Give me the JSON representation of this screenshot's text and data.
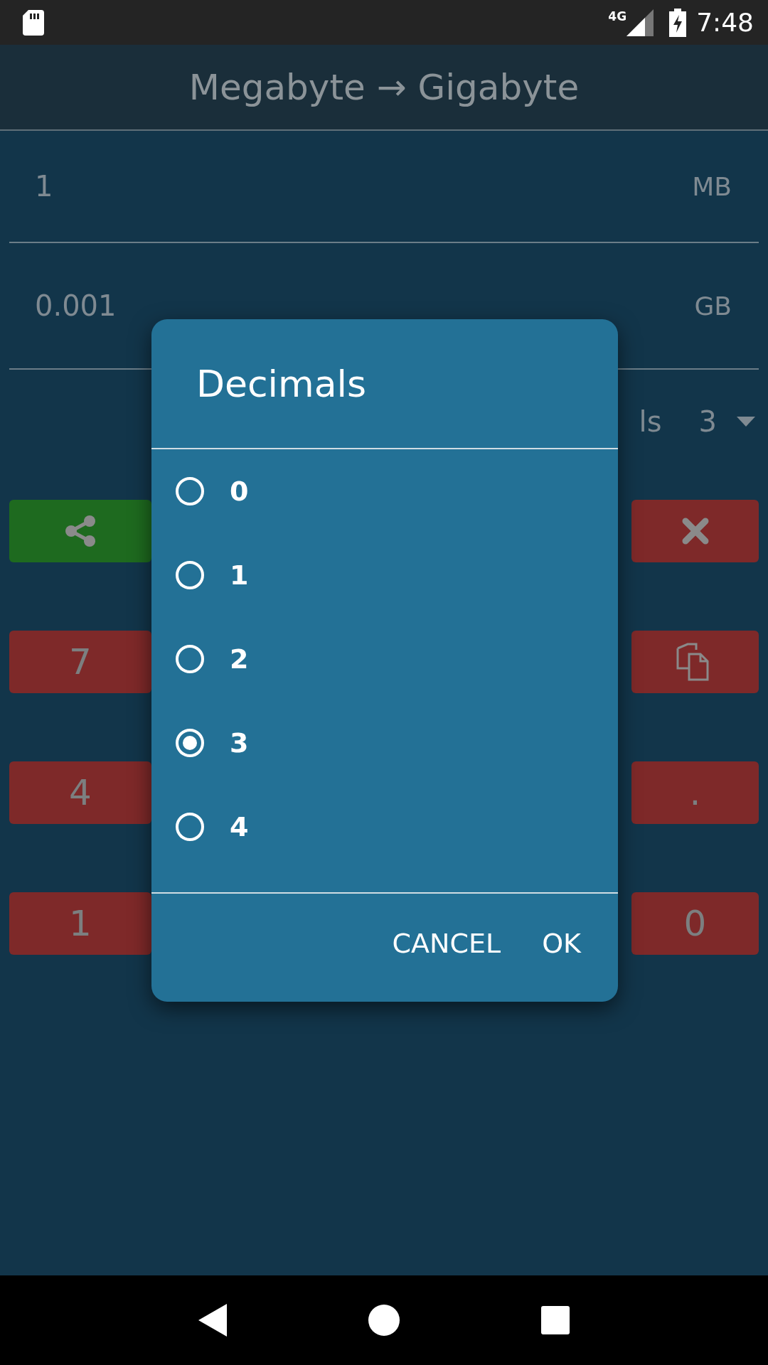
{
  "status_bar": {
    "network": "4G",
    "time": "7:48"
  },
  "title": "Megabyte → Gigabyte",
  "input": {
    "value": "1",
    "unit": "MB"
  },
  "output": {
    "value": "0.001",
    "unit": "GB"
  },
  "decimals": {
    "label": "ls",
    "value": "3"
  },
  "keypad": [
    {
      "left": {
        "kind": "share"
      },
      "right": {
        "kind": "clear"
      }
    },
    {
      "left": {
        "kind": "key",
        "label": "7"
      },
      "right": {
        "kind": "copy"
      }
    },
    {
      "left": {
        "kind": "key",
        "label": "4"
      },
      "right": {
        "kind": "key",
        "label": "."
      }
    },
    {
      "left": {
        "kind": "key",
        "label": "1"
      },
      "right": {
        "kind": "key",
        "label": "0"
      }
    }
  ],
  "dialog": {
    "title": "Decimals",
    "options": [
      {
        "label": "0",
        "selected": false
      },
      {
        "label": "1",
        "selected": false
      },
      {
        "label": "2",
        "selected": false
      },
      {
        "label": "3",
        "selected": true
      },
      {
        "label": "4",
        "selected": false
      }
    ],
    "buttons": [
      "CANCEL",
      "OK"
    ]
  }
}
